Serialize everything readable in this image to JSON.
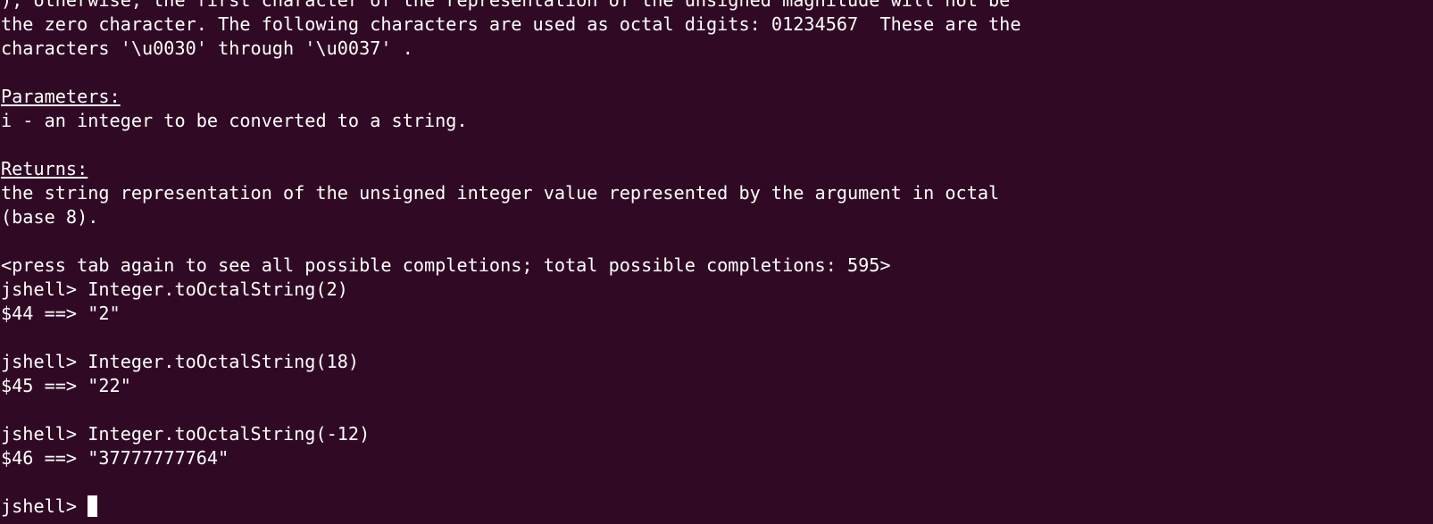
{
  "terminal": {
    "lines": [
      "); otherwise, the first character of the representation of the unsigned magnitude will not be",
      "the zero character. The following characters are used as octal digits: 01234567  These are the",
      "characters '\\u0030' through '\\u0037' .",
      "",
      "Parameters:",
      "i - an integer to be converted to a string.",
      "",
      "Returns:",
      "the string representation of the unsigned integer value represented by the argument in octal",
      "(base 8).",
      "",
      "<press tab again to see all possible completions; total possible completions: 595>",
      "jshell> Integer.toOctalString(2)",
      "$44 ==> \"2\"",
      "",
      "jshell> Integer.toOctalString(18)",
      "$45 ==> \"22\"",
      "",
      "jshell> Integer.toOctalString(-12)",
      "$46 ==> \"37777777764\"",
      "",
      "jshell> "
    ]
  },
  "colors": {
    "background": "#300a24",
    "foreground": "#ffffff"
  }
}
